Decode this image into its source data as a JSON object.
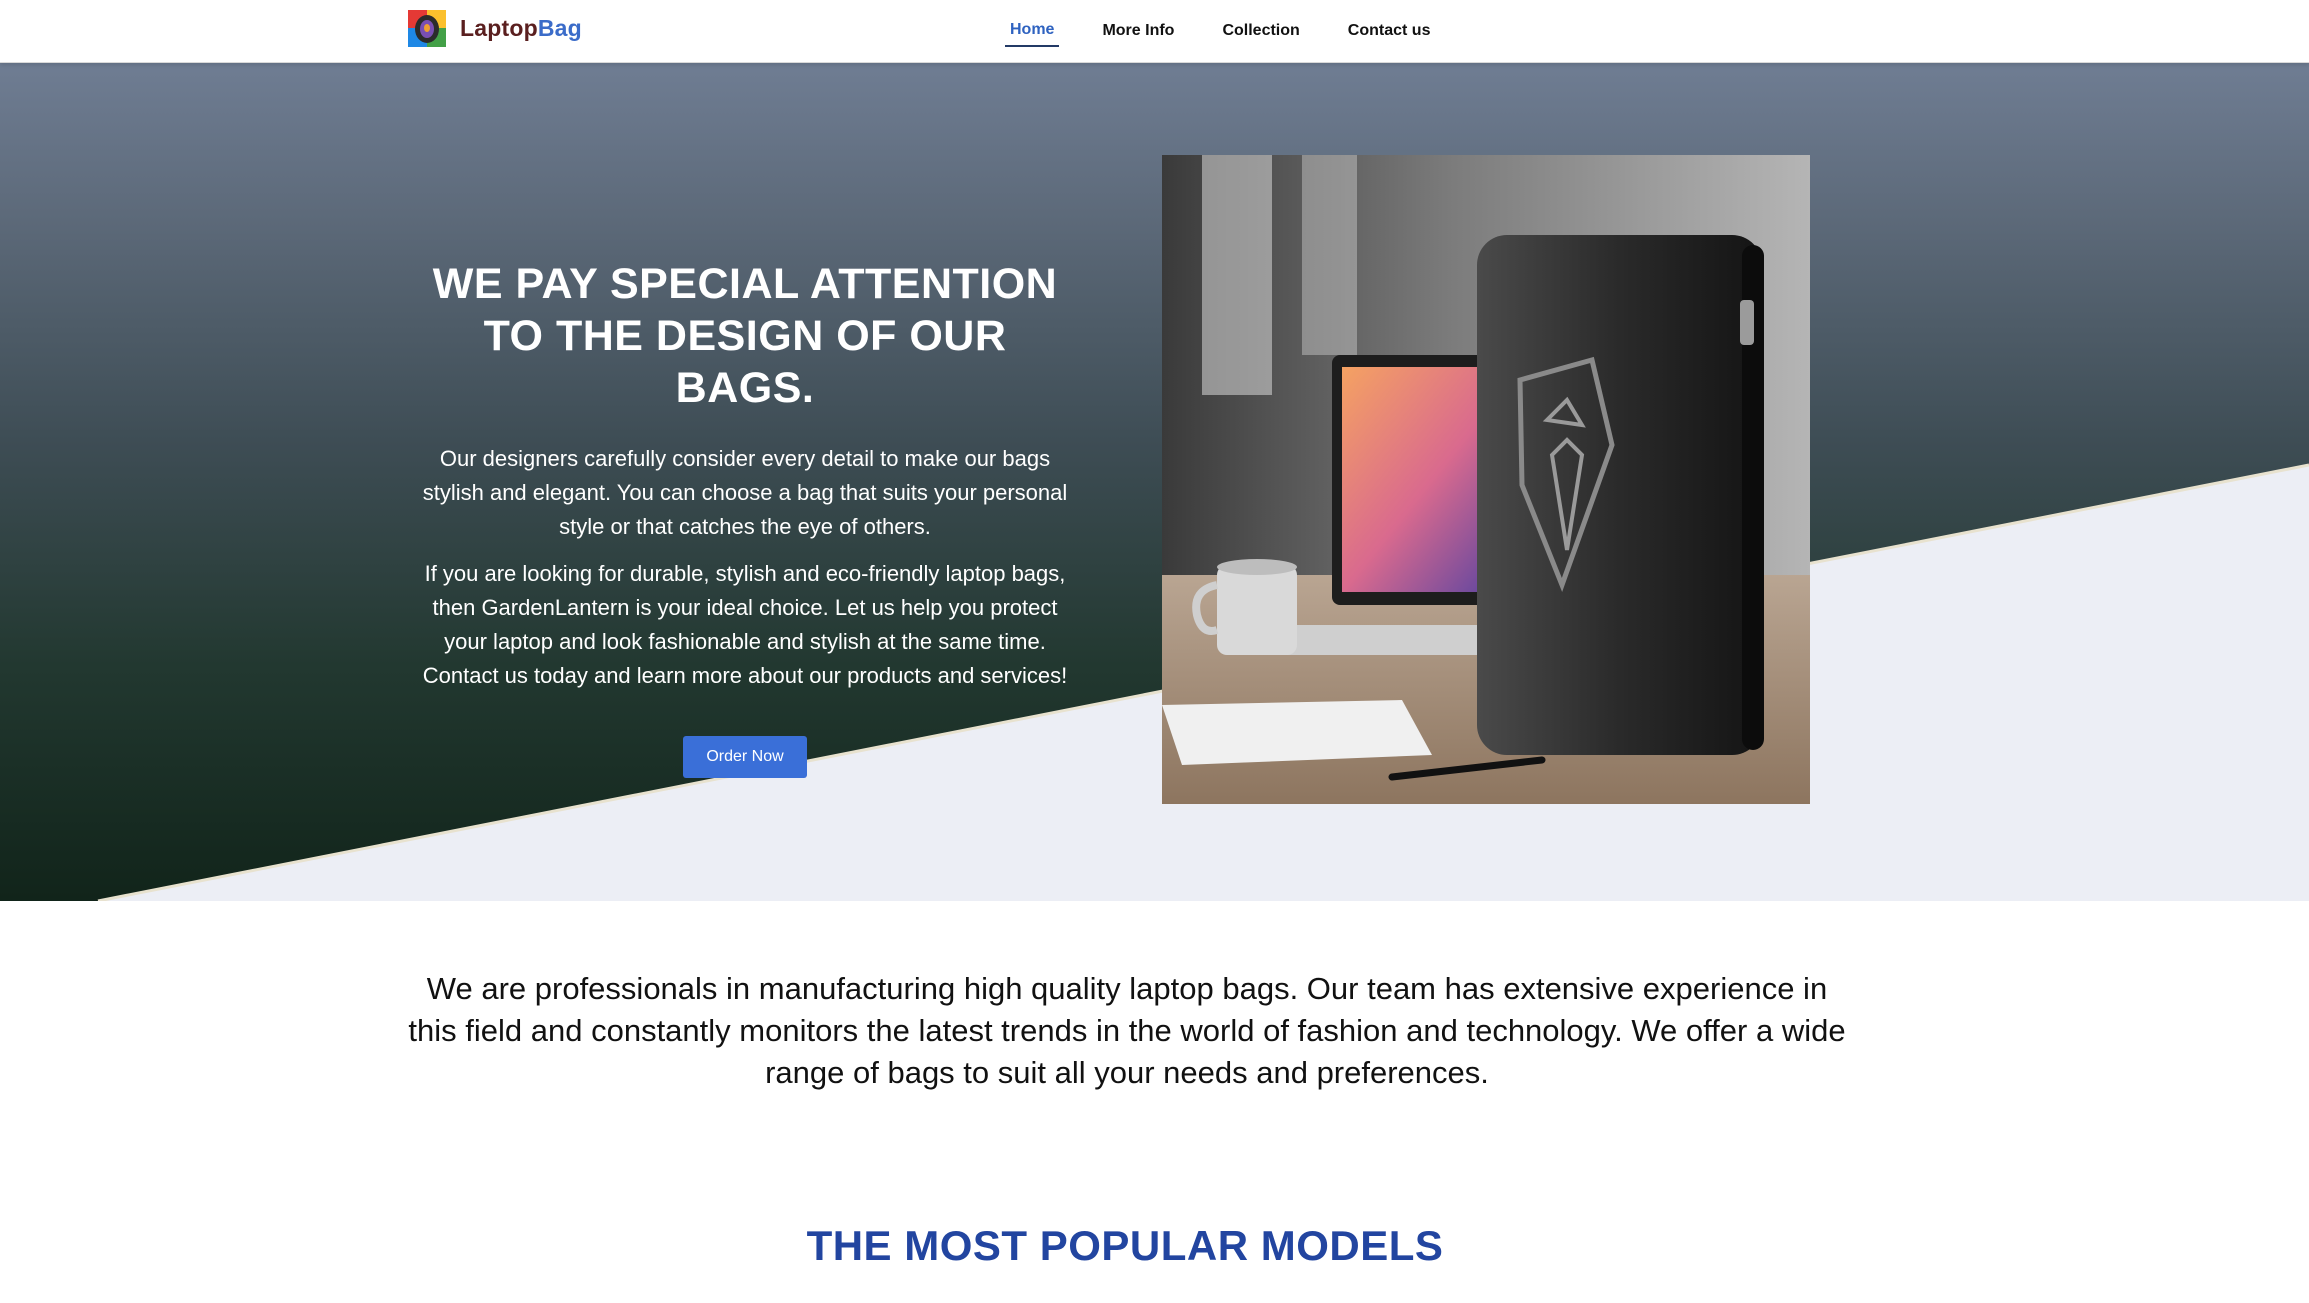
{
  "brand": {
    "part1": "Laptop",
    "part2": "Bag",
    "icon": "logo-icon"
  },
  "nav": [
    {
      "label": "Home",
      "active": true
    },
    {
      "label": "More Info",
      "active": false
    },
    {
      "label": "Collection",
      "active": false
    },
    {
      "label": "Contact us",
      "active": false
    }
  ],
  "hero": {
    "title": "WE PAY SPECIAL ATTENTION TO THE DESIGN OF OUR BAGS.",
    "paragraph1": "Our designers carefully consider every detail to make our bags stylish and elegant. You can choose a bag that suits your personal style or that catches the eye of others.",
    "paragraph2": "If you are looking for durable, stylish and eco-friendly laptop bags, then GardenLantern is your ideal choice. Let us help you protect your laptop and look fashionable and stylish at the same time. Contact us today and learn more about our products and services!",
    "button_label": "Order Now"
  },
  "about_text": "We are professionals in manufacturing high quality laptop bags. Our team has extensive experience in this field and constantly monitors the latest trends in the world of fashion and technology. We offer a wide range of bags to suit all your needs and preferences.",
  "popular_heading": "THE MOST POPULAR MODELS",
  "colors": {
    "accent": "#3a6fd8",
    "heading_blue": "#2245a0",
    "nav_active": "#2e62c0",
    "wedge": "#eceef5"
  }
}
